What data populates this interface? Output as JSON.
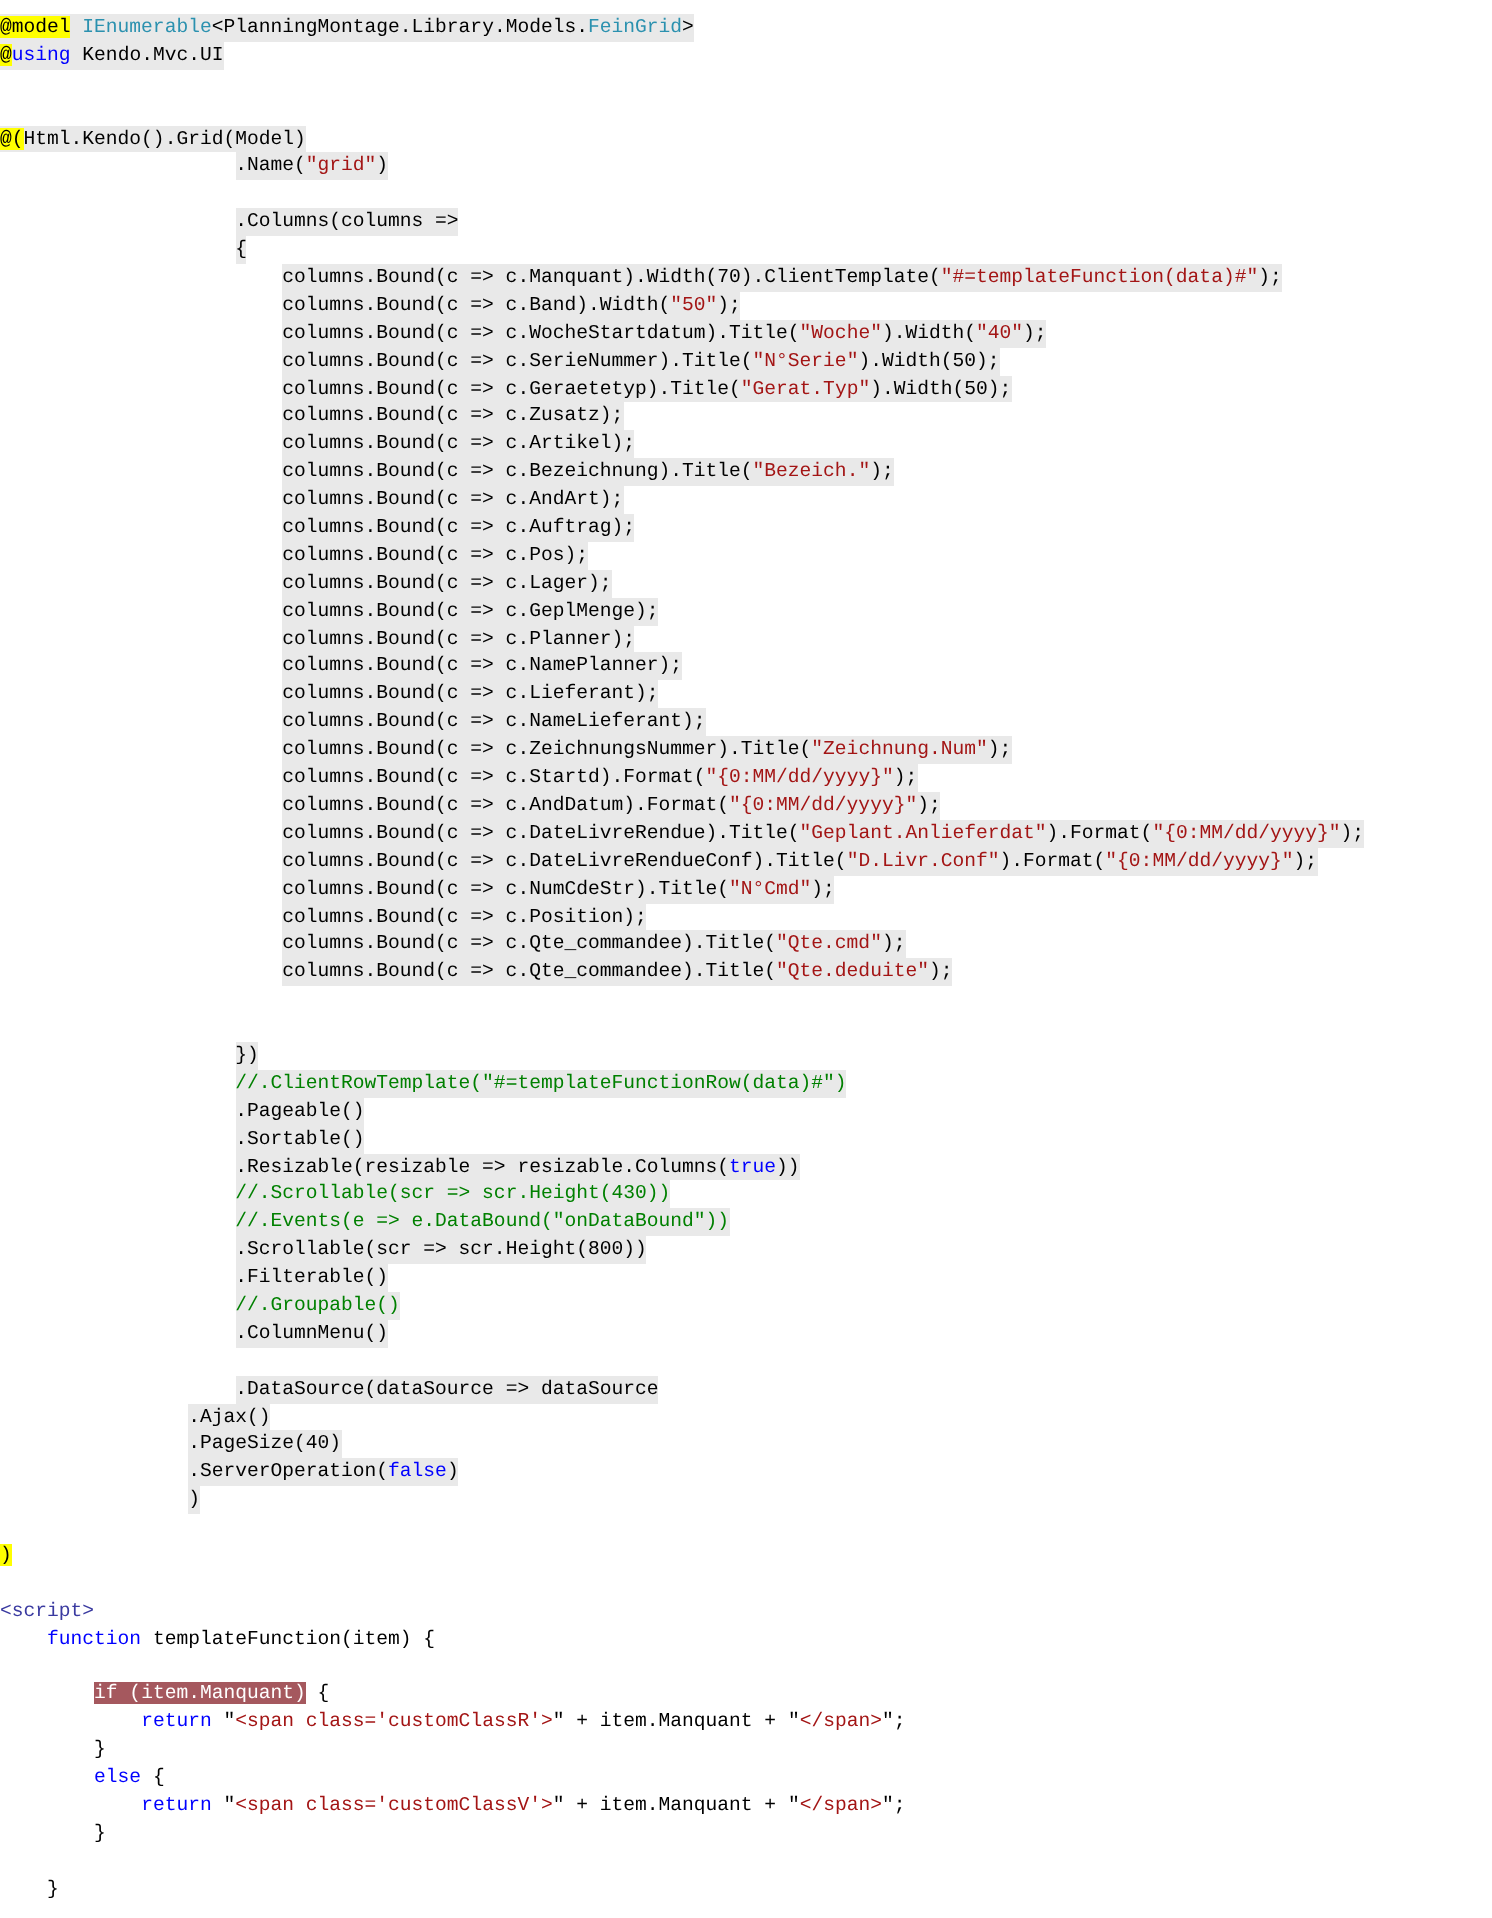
{
  "editor": {
    "lines": [
      {
        "kind": "code",
        "shaded": true,
        "tokens": [
          {
            "kind": "razor",
            "text": "@model"
          },
          {
            "kind": "type",
            "text": " IEnumerable"
          },
          {
            "kind": "plain",
            "text": "<PlanningMontage.Library.Models."
          },
          {
            "kind": "type",
            "text": "FeinGrid"
          },
          {
            "kind": "plain",
            "text": ">"
          }
        ]
      },
      {
        "kind": "code",
        "shaded": true,
        "tokens": [
          {
            "kind": "razor",
            "text": "@"
          },
          {
            "kind": "keyword",
            "text": "using"
          },
          {
            "kind": "plain",
            "text": " Kendo.Mvc.UI"
          }
        ]
      },
      {
        "kind": "blank"
      },
      {
        "kind": "blank"
      },
      {
        "kind": "code",
        "shaded": true,
        "tokens": [
          {
            "kind": "razor",
            "text": "@("
          },
          {
            "kind": "plain",
            "text": "Html.Kendo().Grid(Model)"
          }
        ]
      },
      {
        "kind": "code",
        "shaded": true,
        "tokens": [
          {
            "kind": "plain",
            "text": "                    .Name("
          },
          {
            "kind": "string",
            "text": "\"grid\""
          },
          {
            "kind": "plain",
            "text": ")"
          }
        ]
      },
      {
        "kind": "blank"
      },
      {
        "kind": "code",
        "shaded": true,
        "tokens": [
          {
            "kind": "plain",
            "text": "                    .Columns(columns =>"
          }
        ]
      },
      {
        "kind": "code",
        "shaded": true,
        "tokens": [
          {
            "kind": "plain",
            "text": "                    {"
          }
        ]
      },
      {
        "kind": "code",
        "shaded": true,
        "tokens": [
          {
            "kind": "plain",
            "text": "                        columns.Bound(c => c.Manquant).Width(70).ClientTemplate("
          },
          {
            "kind": "string",
            "text": "\"#=templateFunction(data)#\""
          },
          {
            "kind": "plain",
            "text": ");"
          }
        ]
      },
      {
        "kind": "code",
        "shaded": true,
        "tokens": [
          {
            "kind": "plain",
            "text": "                        columns.Bound(c => c.Band).Width("
          },
          {
            "kind": "string",
            "text": "\"50\""
          },
          {
            "kind": "plain",
            "text": ");"
          }
        ]
      },
      {
        "kind": "code",
        "shaded": true,
        "tokens": [
          {
            "kind": "plain",
            "text": "                        columns.Bound(c => c.WocheStartdatum).Title("
          },
          {
            "kind": "string",
            "text": "\"Woche\""
          },
          {
            "kind": "plain",
            "text": ").Width("
          },
          {
            "kind": "string",
            "text": "\"40\""
          },
          {
            "kind": "plain",
            "text": ");"
          }
        ]
      },
      {
        "kind": "code",
        "shaded": true,
        "tokens": [
          {
            "kind": "plain",
            "text": "                        columns.Bound(c => c.SerieNummer).Title("
          },
          {
            "kind": "string",
            "text": "\"N°Serie\""
          },
          {
            "kind": "plain",
            "text": ").Width(50);"
          }
        ]
      },
      {
        "kind": "code",
        "shaded": true,
        "tokens": [
          {
            "kind": "plain",
            "text": "                        columns.Bound(c => c.Geraetetyp).Title("
          },
          {
            "kind": "string",
            "text": "\"Gerat.Typ\""
          },
          {
            "kind": "plain",
            "text": ").Width(50);"
          }
        ]
      },
      {
        "kind": "code",
        "shaded": true,
        "tokens": [
          {
            "kind": "plain",
            "text": "                        columns.Bound(c => c.Zusatz);"
          }
        ]
      },
      {
        "kind": "code",
        "shaded": true,
        "tokens": [
          {
            "kind": "plain",
            "text": "                        columns.Bound(c => c.Artikel);"
          }
        ]
      },
      {
        "kind": "code",
        "shaded": true,
        "tokens": [
          {
            "kind": "plain",
            "text": "                        columns.Bound(c => c.Bezeichnung).Title("
          },
          {
            "kind": "string",
            "text": "\"Bezeich.\""
          },
          {
            "kind": "plain",
            "text": ");"
          }
        ]
      },
      {
        "kind": "code",
        "shaded": true,
        "tokens": [
          {
            "kind": "plain",
            "text": "                        columns.Bound(c => c.AndArt);"
          }
        ]
      },
      {
        "kind": "code",
        "shaded": true,
        "tokens": [
          {
            "kind": "plain",
            "text": "                        columns.Bound(c => c.Auftrag);"
          }
        ]
      },
      {
        "kind": "code",
        "shaded": true,
        "tokens": [
          {
            "kind": "plain",
            "text": "                        columns.Bound(c => c.Pos);"
          }
        ]
      },
      {
        "kind": "code",
        "shaded": true,
        "tokens": [
          {
            "kind": "plain",
            "text": "                        columns.Bound(c => c.Lager);"
          }
        ]
      },
      {
        "kind": "code",
        "shaded": true,
        "tokens": [
          {
            "kind": "plain",
            "text": "                        columns.Bound(c => c.GeplMenge);"
          }
        ]
      },
      {
        "kind": "code",
        "shaded": true,
        "tokens": [
          {
            "kind": "plain",
            "text": "                        columns.Bound(c => c.Planner);"
          }
        ]
      },
      {
        "kind": "code",
        "shaded": true,
        "tokens": [
          {
            "kind": "plain",
            "text": "                        columns.Bound(c => c.NamePlanner);"
          }
        ]
      },
      {
        "kind": "code",
        "shaded": true,
        "tokens": [
          {
            "kind": "plain",
            "text": "                        columns.Bound(c => c.Lieferant);"
          }
        ]
      },
      {
        "kind": "code",
        "shaded": true,
        "tokens": [
          {
            "kind": "plain",
            "text": "                        columns.Bound(c => c.NameLieferant);"
          }
        ]
      },
      {
        "kind": "code",
        "shaded": true,
        "tokens": [
          {
            "kind": "plain",
            "text": "                        columns.Bound(c => c.ZeichnungsNummer).Title("
          },
          {
            "kind": "string",
            "text": "\"Zeichnung.Num\""
          },
          {
            "kind": "plain",
            "text": ");"
          }
        ]
      },
      {
        "kind": "code",
        "shaded": true,
        "tokens": [
          {
            "kind": "plain",
            "text": "                        columns.Bound(c => c.Startd).Format("
          },
          {
            "kind": "string",
            "text": "\"{0:MM/dd/yyyy}\""
          },
          {
            "kind": "plain",
            "text": ");"
          }
        ]
      },
      {
        "kind": "code",
        "shaded": true,
        "tokens": [
          {
            "kind": "plain",
            "text": "                        columns.Bound(c => c.AndDatum).Format("
          },
          {
            "kind": "string",
            "text": "\"{0:MM/dd/yyyy}\""
          },
          {
            "kind": "plain",
            "text": ");"
          }
        ]
      },
      {
        "kind": "code",
        "shaded": true,
        "tokens": [
          {
            "kind": "plain",
            "text": "                        columns.Bound(c => c.DateLivreRendue).Title("
          },
          {
            "kind": "string",
            "text": "\"Geplant.Anlieferdat\""
          },
          {
            "kind": "plain",
            "text": ").Format("
          },
          {
            "kind": "string",
            "text": "\"{0:MM/dd/yyyy}\""
          },
          {
            "kind": "plain",
            "text": ");"
          }
        ]
      },
      {
        "kind": "code",
        "shaded": true,
        "tokens": [
          {
            "kind": "plain",
            "text": "                        columns.Bound(c => c.DateLivreRendueConf).Title("
          },
          {
            "kind": "string",
            "text": "\"D.Livr.Conf\""
          },
          {
            "kind": "plain",
            "text": ").Format("
          },
          {
            "kind": "string",
            "text": "\"{0:MM/dd/yyyy}\""
          },
          {
            "kind": "plain",
            "text": ");"
          }
        ]
      },
      {
        "kind": "code",
        "shaded": true,
        "tokens": [
          {
            "kind": "plain",
            "text": "                        columns.Bound(c => c.NumCdeStr).Title("
          },
          {
            "kind": "string",
            "text": "\"N°Cmd\""
          },
          {
            "kind": "plain",
            "text": ");"
          }
        ]
      },
      {
        "kind": "code",
        "shaded": true,
        "tokens": [
          {
            "kind": "plain",
            "text": "                        columns.Bound(c => c.Position);"
          }
        ]
      },
      {
        "kind": "code",
        "shaded": true,
        "tokens": [
          {
            "kind": "plain",
            "text": "                        columns.Bound(c => c.Qte_commandee).Title("
          },
          {
            "kind": "string",
            "text": "\"Qte.cmd\""
          },
          {
            "kind": "plain",
            "text": ");"
          }
        ]
      },
      {
        "kind": "code",
        "shaded": true,
        "tokens": [
          {
            "kind": "plain",
            "text": "                        columns.Bound(c => c.Qte_commandee).Title("
          },
          {
            "kind": "string",
            "text": "\"Qte.deduite\""
          },
          {
            "kind": "plain",
            "text": ");"
          }
        ]
      },
      {
        "kind": "blank"
      },
      {
        "kind": "blank"
      },
      {
        "kind": "code",
        "shaded": true,
        "tokens": [
          {
            "kind": "plain",
            "text": "                    })"
          }
        ]
      },
      {
        "kind": "code",
        "shaded": true,
        "tokens": [
          {
            "kind": "comment",
            "text": "                    //.ClientRowTemplate(\"#=templateFunctionRow(data)#\")"
          }
        ]
      },
      {
        "kind": "code",
        "shaded": true,
        "tokens": [
          {
            "kind": "plain",
            "text": "                    .Pageable()"
          }
        ]
      },
      {
        "kind": "code",
        "shaded": true,
        "tokens": [
          {
            "kind": "plain",
            "text": "                    .Sortable()"
          }
        ]
      },
      {
        "kind": "code",
        "shaded": true,
        "tokens": [
          {
            "kind": "plain",
            "text": "                    .Resizable(resizable => resizable.Columns("
          },
          {
            "kind": "keyword",
            "text": "true"
          },
          {
            "kind": "plain",
            "text": "))"
          }
        ]
      },
      {
        "kind": "code",
        "shaded": true,
        "tokens": [
          {
            "kind": "comment",
            "text": "                    //.Scrollable(scr => scr.Height(430))"
          }
        ]
      },
      {
        "kind": "code",
        "shaded": true,
        "tokens": [
          {
            "kind": "comment",
            "text": "                    //.Events(e => e.DataBound(\"onDataBound\"))"
          }
        ]
      },
      {
        "kind": "code",
        "shaded": true,
        "tokens": [
          {
            "kind": "plain",
            "text": "                    .Scrollable(scr => scr.Height(800))"
          }
        ]
      },
      {
        "kind": "code",
        "shaded": true,
        "tokens": [
          {
            "kind": "plain",
            "text": "                    .Filterable()"
          }
        ]
      },
      {
        "kind": "code",
        "shaded": true,
        "tokens": [
          {
            "kind": "comment",
            "text": "                    //.Groupable()"
          }
        ]
      },
      {
        "kind": "code",
        "shaded": true,
        "tokens": [
          {
            "kind": "plain",
            "text": "                    .ColumnMenu()"
          }
        ]
      },
      {
        "kind": "blank"
      },
      {
        "kind": "code",
        "shaded": true,
        "tokens": [
          {
            "kind": "plain",
            "text": "                    .DataSource(dataSource => dataSource"
          }
        ]
      },
      {
        "kind": "code",
        "shaded": true,
        "tokens": [
          {
            "kind": "plain",
            "text": "                .Ajax()"
          }
        ]
      },
      {
        "kind": "code",
        "shaded": true,
        "tokens": [
          {
            "kind": "plain",
            "text": "                .PageSize(40)"
          }
        ]
      },
      {
        "kind": "code",
        "shaded": true,
        "tokens": [
          {
            "kind": "plain",
            "text": "                .ServerOperation("
          },
          {
            "kind": "keyword",
            "text": "false"
          },
          {
            "kind": "plain",
            "text": ")"
          }
        ]
      },
      {
        "kind": "code",
        "shaded": true,
        "tokens": [
          {
            "kind": "plain",
            "text": "                )"
          }
        ]
      },
      {
        "kind": "blank"
      },
      {
        "kind": "code",
        "shaded": false,
        "tokens": [
          {
            "kind": "razor",
            "text": ")"
          }
        ]
      },
      {
        "kind": "blank"
      },
      {
        "kind": "code",
        "shaded": false,
        "tokens": [
          {
            "kind": "tag",
            "text": "<script>"
          }
        ]
      },
      {
        "kind": "code",
        "shaded": false,
        "tokens": [
          {
            "kind": "keyword",
            "text": "    function"
          },
          {
            "kind": "plain",
            "text": " templateFunction(item) {"
          }
        ]
      },
      {
        "kind": "blank"
      },
      {
        "kind": "code",
        "shaded": false,
        "tokens": [
          {
            "kind": "highlight",
            "text": "        if (item.Manquant)"
          },
          {
            "kind": "plain",
            "text": " {"
          }
        ]
      },
      {
        "kind": "code",
        "shaded": false,
        "tokens": [
          {
            "kind": "keyword",
            "text": "            return"
          },
          {
            "kind": "plain",
            "text": " \""
          },
          {
            "kind": "string",
            "text": "<span class='customClassR'>"
          },
          {
            "kind": "plain",
            "text": "\" + item.Manquant + \""
          },
          {
            "kind": "string",
            "text": "</span>"
          },
          {
            "kind": "plain",
            "text": "\";"
          }
        ]
      },
      {
        "kind": "code",
        "shaded": false,
        "tokens": [
          {
            "kind": "plain",
            "text": "        }"
          }
        ]
      },
      {
        "kind": "code",
        "shaded": false,
        "tokens": [
          {
            "kind": "keyword",
            "text": "        else"
          },
          {
            "kind": "plain",
            "text": " {"
          }
        ]
      },
      {
        "kind": "code",
        "shaded": false,
        "tokens": [
          {
            "kind": "keyword",
            "text": "            return"
          },
          {
            "kind": "plain",
            "text": " \""
          },
          {
            "kind": "string",
            "text": "<span class='customClassV'>"
          },
          {
            "kind": "plain",
            "text": "\" + item.Manquant + \""
          },
          {
            "kind": "string",
            "text": "</span>"
          },
          {
            "kind": "plain",
            "text": "\";"
          }
        ]
      },
      {
        "kind": "code",
        "shaded": false,
        "tokens": [
          {
            "kind": "plain",
            "text": "        }"
          }
        ]
      },
      {
        "kind": "blank"
      },
      {
        "kind": "code",
        "shaded": false,
        "tokens": [
          {
            "kind": "plain",
            "text": "    }"
          }
        ]
      }
    ]
  }
}
